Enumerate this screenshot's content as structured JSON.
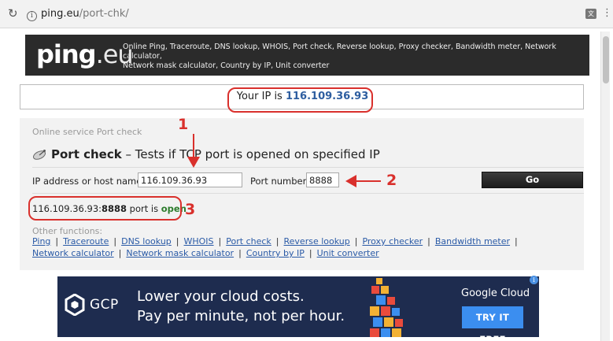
{
  "browser": {
    "url_host": "ping.eu",
    "url_path": "/port-chk/"
  },
  "header": {
    "logo_main": "ping",
    "logo_suffix": ".eu",
    "description_line1": "Online Ping, Traceroute, DNS lookup, WHOIS, Port check, Reverse lookup, Proxy checker, Bandwidth meter, Network calculator,",
    "description_line2": "Network mask calculator, Country by IP, Unit converter"
  },
  "ip_info": {
    "prefix": "Your IP is ",
    "ip": "116.109.36.93"
  },
  "service": {
    "caption": "Online service Port check",
    "title_bold": "Port check",
    "title_rest": " – Tests if TCP port is opened on specified IP",
    "ip_label": "IP address or host name:",
    "ip_value": "116.109.36.93",
    "port_label": "Port number:",
    "port_value": "8888",
    "go_label": "Go",
    "result_ip": "116.109.36.93",
    "result_colon": ":",
    "result_port": "8888",
    "result_middle": " port is ",
    "result_status": "open",
    "other_label": "Other functions:",
    "links_row1": [
      "Ping",
      "Traceroute",
      "DNS lookup",
      "WHOIS",
      "Port check",
      "Reverse lookup",
      "Proxy checker",
      "Bandwidth meter"
    ],
    "links_row2": [
      "Network calculator",
      "Network mask calculator",
      "Country by IP",
      "Unit converter"
    ],
    "separator": "|"
  },
  "annotations": {
    "one": "1",
    "two": "2",
    "three": "3"
  },
  "ad": {
    "gcp": "GCP",
    "line1": "Lower your cloud costs.",
    "line2": "Pay per minute, not per hour.",
    "brand": "Google Cloud",
    "cta": "TRY IT FREE"
  },
  "colors": {
    "annotation_red": "#d9302c",
    "link_blue": "#2a5aa6",
    "ip_blue": "#2e5ea0",
    "open_green": "#2e7d2e",
    "header_dark": "#2b2b2b",
    "ad_navy": "#1e2c4f",
    "cta_blue": "#3b8ef0"
  },
  "icons": {
    "reload": "reload-icon",
    "info": "info-icon",
    "translate": "translate-icon",
    "menu": "menu-icon",
    "satellite": "satellite-dish-icon",
    "gcp_logo": "gcp-hexagon-icon",
    "ad_info": "ad-info-icon"
  }
}
